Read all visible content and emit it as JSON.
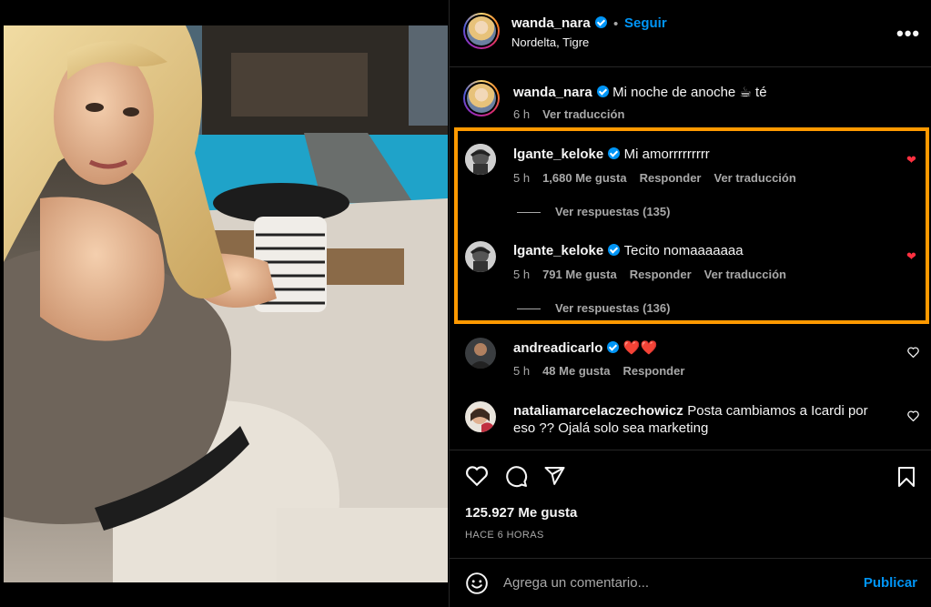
{
  "post": {
    "username": "wanda_nara",
    "follow_label": "Seguir",
    "separator": "•",
    "location": "Nordelta, Tigre",
    "more_label": "•••"
  },
  "caption": {
    "username": "wanda_nara",
    "text": "Mi noche de anoche ☕ té",
    "time": "6 h",
    "translate": "Ver traducción"
  },
  "comments": [
    {
      "username": "lgante_keloke",
      "text": "Mi amorrrrrrrrr",
      "time": "5 h",
      "likes": "1,680 Me gusta",
      "reply": "Responder",
      "translate": "Ver traducción",
      "replies": "Ver respuestas (135)",
      "liked": true
    },
    {
      "username": "lgante_keloke",
      "text": "Tecito nomaaaaaaa",
      "time": "5 h",
      "likes": "791 Me gusta",
      "reply": "Responder",
      "translate": "Ver traducción",
      "replies": "Ver respuestas (136)",
      "liked": true
    },
    {
      "username": "andreadicarlo",
      "text": "❤️❤️",
      "time": "5 h",
      "likes": "48 Me gusta",
      "reply": "Responder",
      "liked": false
    },
    {
      "username": "nataliamarcelaczechowicz",
      "text": "Posta cambiamos a Icardi por",
      "text2": "eso ?? Ojalá solo sea marketing",
      "liked": false
    }
  ],
  "stats": {
    "likes": "125.927 Me gusta",
    "time_ago": "HACE 6 HORAS"
  },
  "composer": {
    "placeholder": "Agrega un comentario...",
    "publish": "Publicar"
  },
  "colors": {
    "accent": "#0095f6",
    "highlight": "#ff9900",
    "like_red": "#ff3040"
  },
  "icons": [
    "verified-badge-icon",
    "more-options-icon",
    "heart-icon",
    "comment-icon",
    "share-icon",
    "bookmark-icon",
    "emoji-icon"
  ]
}
